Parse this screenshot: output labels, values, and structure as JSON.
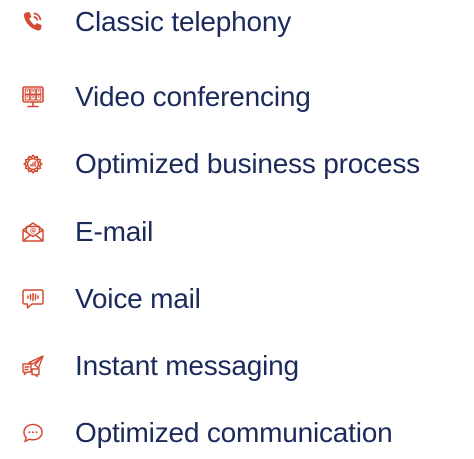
{
  "colors": {
    "text": "#1b2a5b",
    "icon_accent": "#d24a33"
  },
  "features": [
    {
      "label": "Classic telephony",
      "icon": "phone-ringing-icon"
    },
    {
      "label": "Video conferencing",
      "icon": "video-conference-monitor-icon"
    },
    {
      "label": "Optimized business process",
      "icon": "gear-chart-icon"
    },
    {
      "label": "E-mail",
      "icon": "envelope-at-icon"
    },
    {
      "label": "Voice mail",
      "icon": "voice-bubble-icon"
    },
    {
      "label": "Instant messaging",
      "icon": "paper-plane-chat-icon"
    },
    {
      "label": "Optimized communication",
      "icon": "chat-bubble-icon"
    }
  ]
}
